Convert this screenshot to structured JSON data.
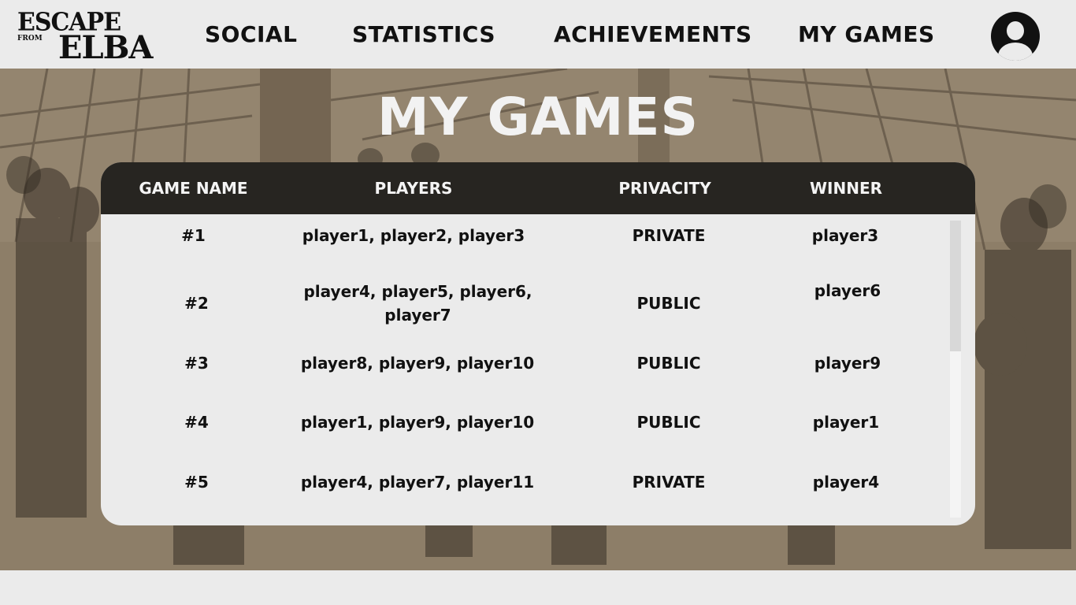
{
  "app": {
    "logo_line1": "ESCAPE",
    "logo_line2a": "FROM",
    "logo_line3": "ELBA"
  },
  "nav": {
    "items": [
      {
        "label": "SOCIAL"
      },
      {
        "label": "STATISTICS"
      },
      {
        "label": "ACHIEVEMENTS"
      },
      {
        "label": "MY GAMES"
      }
    ],
    "avatar_icon": "user-avatar-icon"
  },
  "page": {
    "title": "MY GAMES"
  },
  "table": {
    "columns": [
      "GAME NAME",
      "PLAYERS",
      "PRIVACITY",
      "WINNER"
    ],
    "rows": [
      {
        "game": "#1",
        "players": "player1, player2, player3",
        "privacy": "PRIVATE",
        "winner": "player3"
      },
      {
        "game": "#2",
        "players": "player4, player5, player6, player7",
        "privacy": "PUBLIC",
        "winner": "player6"
      },
      {
        "game": "#3",
        "players": "player8, player9, player10",
        "privacy": "PUBLIC",
        "winner": "player9"
      },
      {
        "game": "#4",
        "players": "player1, player9, player10",
        "privacy": "PUBLIC",
        "winner": "player1"
      },
      {
        "game": "#5",
        "players": "player4, player7, player11",
        "privacy": "PRIVATE",
        "winner": "player4"
      }
    ]
  },
  "colors": {
    "header_bg": "#ebebeb",
    "table_header_bg": "#272521",
    "scene_tint": "#8a7a64",
    "title_text": "#f2f2f2"
  }
}
